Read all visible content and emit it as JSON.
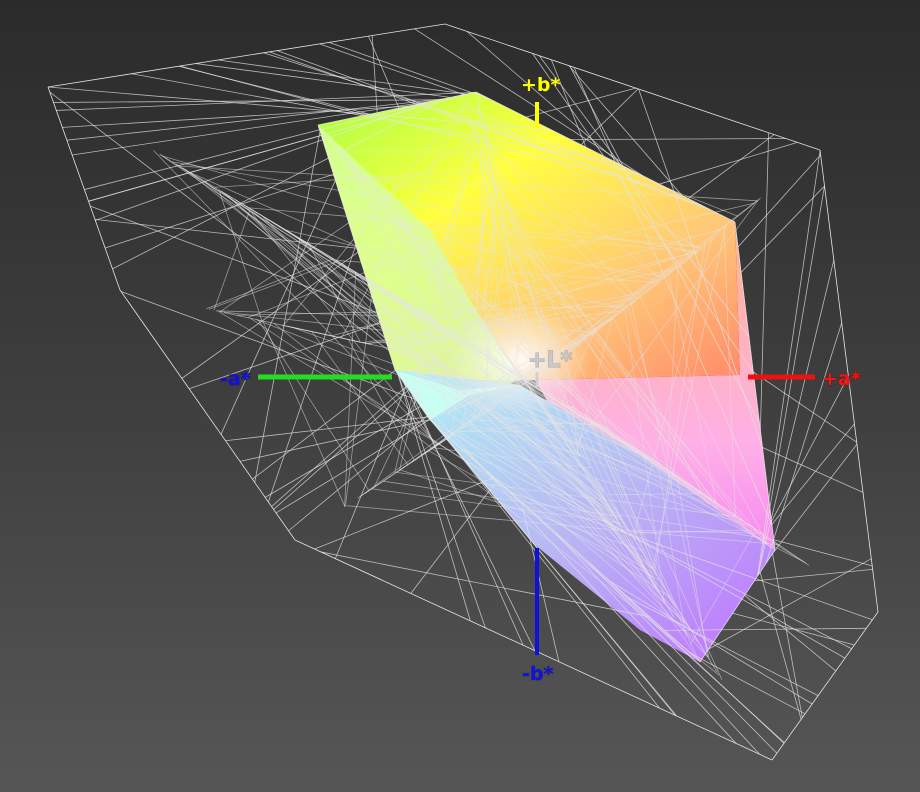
{
  "view": {
    "title": "",
    "background_top": "#2b2b2b",
    "background_bottom": "#565656"
  },
  "axes": {
    "plus_b": {
      "label": "+b*",
      "color": "#ffff00"
    },
    "minus_b": {
      "label": "-b*",
      "color": "#1010e0"
    },
    "plus_a": {
      "label": "+a*",
      "color": "#ff1010"
    },
    "minus_a": {
      "label": "-a*",
      "color": "#1010e0"
    },
    "plus_l": {
      "label": "+L*",
      "color": "#c8c8c8"
    },
    "minus_a_line_color": "#22dd22",
    "plus_a_line_color": "#ee1111"
  },
  "wireframe": {
    "color": "#e6e6e6"
  },
  "gamut_solid": {
    "yellow": "#ffff30",
    "orange": "#ff9966",
    "green": "#88ff44",
    "cyan": "#88f0ff",
    "magenta": "#ee44ff",
    "purple": "#9966ff",
    "white": "#ffffff"
  }
}
